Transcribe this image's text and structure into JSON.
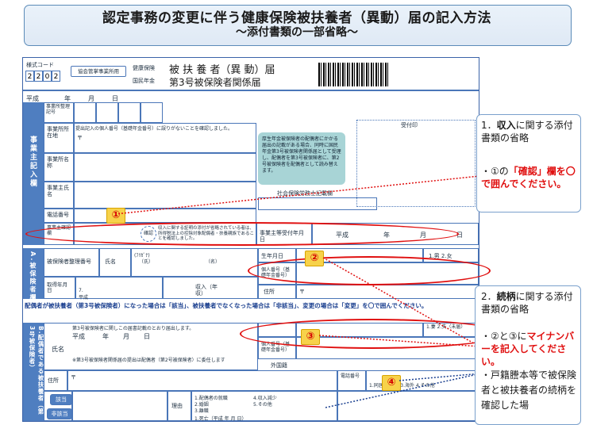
{
  "header": {
    "title": "認定事務の変更に伴う健康保険被扶養者（異動）届の記入方法",
    "subtitle": "～添付書類の一部省略～"
  },
  "form": {
    "form_code_label": "様式コード",
    "form_code_digits": [
      "2",
      "2",
      "0",
      "2"
    ],
    "issuer_stamp": "協会管掌事業所用",
    "kenko_label": "健康保険",
    "kokumin_label": "国民年金",
    "form_title": "被 扶 養 者（異 動）届",
    "form_subtitle": "第3号被保険者関係届",
    "heisei": "平成",
    "year": "年",
    "month": "月",
    "day": "日",
    "office_code_label": "事業所整理記号",
    "received_stamp": "受付印",
    "employer_section": "事業主記入欄",
    "address_label": "事業所所在地",
    "name_label": "事業所名称",
    "owner_label": "事業主氏名",
    "phone_label": "電話番号",
    "postal": "〒",
    "confirm_note": "提出記入の個人番号（基礎年金番号）に誤りがないことを確認しました。",
    "info_box": "厚生年金被保険者の配偶者にかかる届出の記載がある場合、同時に国民年金第3号被保険者関係届として受理し、配偶者を第3号被保険者に、第2号被保険者を配偶者として読み替えます。",
    "social_insurance_label": "社会保険労務士記載欄",
    "owner_confirm_label": "事業主確認欄",
    "owner_confirm_text": "収入に関する証明の添付が省略されている者は、所得税法上の控除対象配偶者・扶養親族であることを確認しました。",
    "confirm_check": "確認",
    "owner_date_label": "事業主等受付年月日",
    "sectionA_label": "A.被保険者欄",
    "insured_number_label": "被保険者整理番号",
    "furigana": "(ﾌﾘｶﾞﾅ)",
    "name_field": "氏名",
    "surname_hint": "（氏）",
    "given_hint": "（名）",
    "dob_label": "生年月日",
    "mynumber_label": "個人番号（基礎年金番号）",
    "acquired_label": "取得年月日",
    "income_label": "収入（年収）",
    "address_field": "住所",
    "gender": "1.男 2.女",
    "warning": "配偶者が被扶養者（第3号被保険者）になった場合は「該当」、被扶養者でなくなった場合は「非該当」、変更の場合は「変更」を〇で囲んでください。",
    "sectionB_label": "B.配偶者である被扶養者（第3号被保険者）",
    "spouse_note": "第3号被保険者に関しこの届書記載のとおり届出します。",
    "spouse_bottom": "※第3号被保険者関係届の提出は配偶者（第2号被保険者）に委任します",
    "foreign_label": "外国籍",
    "relation_label": "続柄",
    "phone_field": "電話番号",
    "gaitou": "該当",
    "hi_gaitou": "非該当",
    "reason_label": "理由",
    "reason_items": [
      "1.配偶者の就職",
      "2.婚姻",
      "3.離職",
      "4.収入減少",
      "5.その他"
    ],
    "death_item": "1.死亡（平成 年 月 日）",
    "relation_options": "1.妻 2.夫（未届）",
    "seven": "7.",
    "heisei_short": "平成",
    "living_options": "1.同居 2.別居 3.海外 4.その他"
  },
  "markers": {
    "m1": "①",
    "m2": "②",
    "m3": "③",
    "m4": "④"
  },
  "callouts": {
    "c1_title_pre": "1．",
    "c1_title_bold": "収入",
    "c1_title_post": "に関する添付書類の省略",
    "c1_body_pre": "・①の",
    "c1_body_red1": "「確認」",
    "c1_body_red2": "欄を〇で囲んでください。",
    "c2_title_pre": "2．",
    "c2_title_bold": "続柄",
    "c2_title_post": "に関する添付書類の省略",
    "c2_line1_pre": "・②と③に",
    "c2_line1_red": "マイナンバーを記入してください。",
    "c2_line2": "・戸籍謄本等で被保険者と被扶養者の続柄を確認した場"
  },
  "colors": {
    "accent_blue": "#4f7ec0",
    "highlight_red": "#e01010",
    "badge_yellow": "#f7d24a",
    "info_teal": "#a8d4d6"
  }
}
